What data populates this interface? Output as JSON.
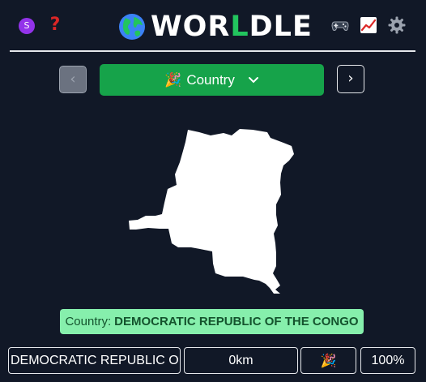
{
  "header": {
    "avatar_letter": "S",
    "help_label": "?",
    "logo": {
      "part1": "WOR",
      "part2": "L",
      "part3": "DLE"
    },
    "icons": [
      "avatar-icon",
      "help-icon",
      "globe-icon",
      "games-icon",
      "stats-icon",
      "gear-icon"
    ]
  },
  "toolbar": {
    "prev_label": "‹",
    "mode_emoji": "🎉",
    "mode_label": "Country",
    "mode_chevron": "⌄",
    "next_label": "›"
  },
  "answer": {
    "label": "Country:",
    "value": "DEMOCRATIC REPUBLIC OF THE CONGO"
  },
  "guesses": [
    {
      "name": "DEMOCRATIC REPUBLIC OF...",
      "distance": "0km",
      "direction": "🎉",
      "proximity": "100%"
    }
  ],
  "colors": {
    "background": "#111827",
    "accent_green": "#16a34a",
    "answer_bg": "#86efac",
    "answer_text": "#14532d",
    "logo_l": "#22c55e",
    "avatar": "#9333ea",
    "help": "#dc2626"
  }
}
